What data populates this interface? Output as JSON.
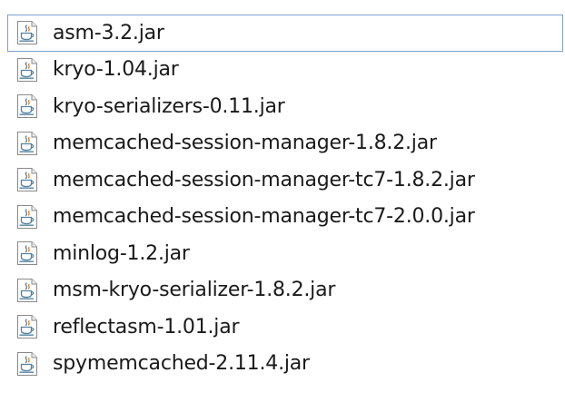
{
  "files": [
    {
      "name": "asm-3.2.jar",
      "icon": "java-jar-file-icon",
      "selected": true
    },
    {
      "name": "kryo-1.04.jar",
      "icon": "java-jar-file-icon",
      "selected": false
    },
    {
      "name": "kryo-serializers-0.11.jar",
      "icon": "java-jar-file-icon",
      "selected": false
    },
    {
      "name": "memcached-session-manager-1.8.2.jar",
      "icon": "java-jar-file-icon",
      "selected": false
    },
    {
      "name": "memcached-session-manager-tc7-1.8.2.jar",
      "icon": "java-jar-file-icon",
      "selected": false
    },
    {
      "name": "memcached-session-manager-tc7-2.0.0.jar",
      "icon": "java-jar-file-icon",
      "selected": false
    },
    {
      "name": "minlog-1.2.jar",
      "icon": "java-jar-file-icon",
      "selected": false
    },
    {
      "name": "msm-kryo-serializer-1.8.2.jar",
      "icon": "java-jar-file-icon",
      "selected": false
    },
    {
      "name": "reflectasm-1.01.jar",
      "icon": "java-jar-file-icon",
      "selected": false
    },
    {
      "name": "spymemcached-2.11.4.jar",
      "icon": "java-jar-file-icon",
      "selected": false
    }
  ],
  "colors": {
    "selection_border": "#7da2ce",
    "icon_cup": "#e76f00",
    "icon_steam": "#5382a1"
  }
}
